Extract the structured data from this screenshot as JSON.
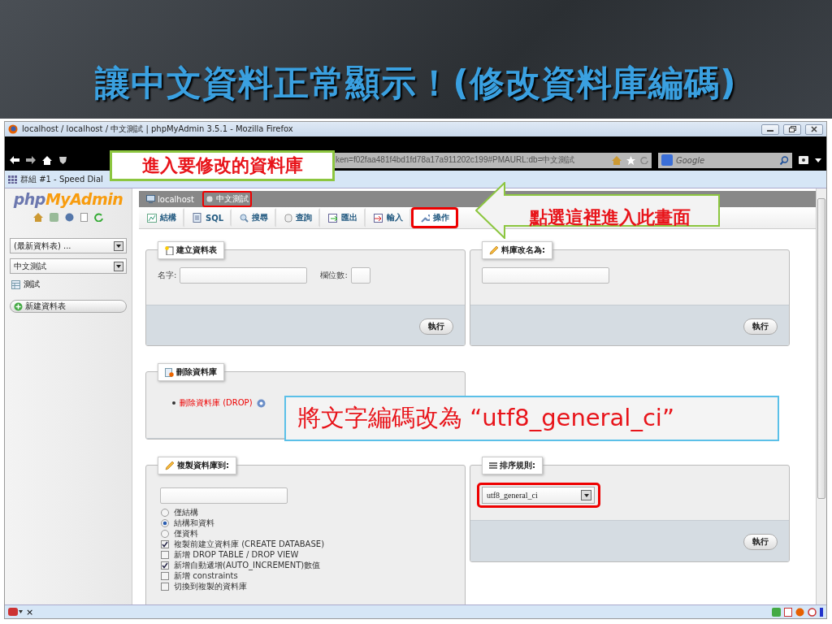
{
  "slide_title": "讓中文資料正常顯示！(修改資料庫編碼)",
  "window": {
    "title": "localhost / localhost / 中文測試 | phpMyAdmin 3.5.1 - Mozilla Firefox",
    "url": "ken=f02faa481f4bd1fd78a17a911202c199#PMAURL:db=中文測試",
    "search_placeholder": "Google",
    "bookmark": "群組 #1 - Speed Dial"
  },
  "sidebar": {
    "logo_php": "php",
    "logo_name": "MyAdmin",
    "table_select": "(最新資料表) ...",
    "db_select": "中文測試",
    "tables": [
      "測試"
    ],
    "new_table": "新建資料表"
  },
  "breadcrumb": [
    {
      "label": "localhost",
      "selected": false
    },
    {
      "label": "中文測試",
      "selected": true
    }
  ],
  "tabs": [
    {
      "label": "結構",
      "selected": false
    },
    {
      "label": "SQL",
      "selected": false
    },
    {
      "label": "搜尋",
      "selected": false
    },
    {
      "label": "查詢",
      "selected": false
    },
    {
      "label": "匯出",
      "selected": false
    },
    {
      "label": "輸入",
      "selected": false
    },
    {
      "label": "操作",
      "selected": true
    }
  ],
  "create_table": {
    "legend": "建立資料表",
    "name_label": "名字:",
    "columns_label": "欄位數:",
    "button": "執行"
  },
  "rename": {
    "legend": "料庫改名為:",
    "button": "執行"
  },
  "drop": {
    "legend": "刪除資料庫",
    "link": "刪除資料庫 (DROP)"
  },
  "copy": {
    "legend": "複製資料庫到:",
    "options": [
      {
        "kind": "radio",
        "label": "僅結構",
        "checked": false
      },
      {
        "kind": "radio",
        "label": "結構和資料",
        "checked": true
      },
      {
        "kind": "radio",
        "label": "僅資料",
        "checked": false
      },
      {
        "kind": "checkbox",
        "label": "複製前建立資料庫 (CREATE DATABASE)",
        "checked": true
      },
      {
        "kind": "checkbox",
        "label": "新增 DROP TABLE / DROP VIEW",
        "checked": false
      },
      {
        "kind": "checkbox",
        "label": "新增自動遞增(AUTO_INCREMENT)數值",
        "checked": true
      },
      {
        "kind": "checkbox",
        "label": "新增 constraints",
        "checked": false
      },
      {
        "kind": "checkbox",
        "label": "切換到複製的資料庫",
        "checked": false
      }
    ]
  },
  "collation": {
    "legend": "排序規則:",
    "value": "utf8_general_ci",
    "button": "執行"
  },
  "callouts": [
    {
      "kind": "box",
      "text": "進入要修改的資料庫"
    },
    {
      "kind": "arrow",
      "text": "點選這裡進入此畫面"
    },
    {
      "kind": "note",
      "text": "將文字編碼改為 “utf8_general_ci”"
    }
  ],
  "status_bar": {
    "close": "×"
  }
}
